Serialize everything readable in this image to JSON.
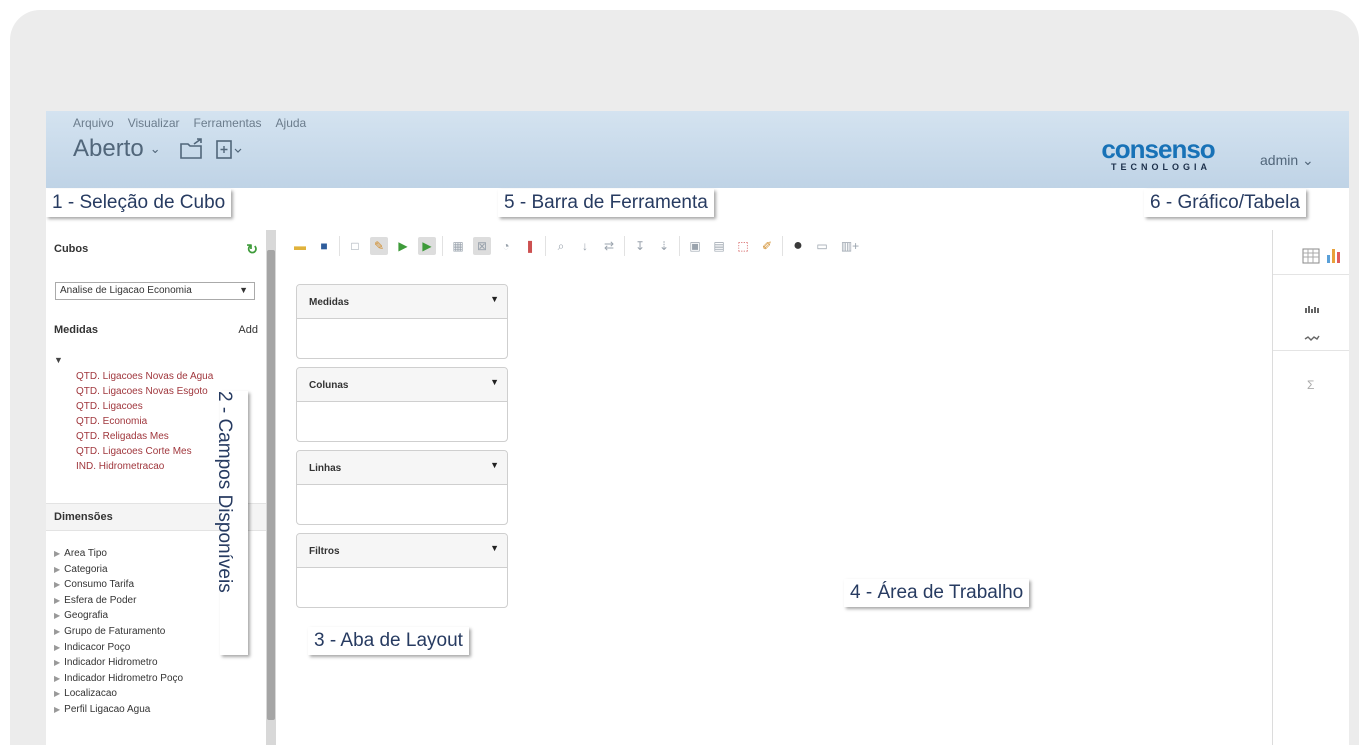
{
  "menu": [
    "Arquivo",
    "Visualizar",
    "Ferramentas",
    "Ajuda"
  ],
  "header": {
    "open_label": "Aberto",
    "open_chevron": "⌄",
    "logo_main": "consenso",
    "logo_sub": "TECNOLOGIA",
    "user": "admin ⌄"
  },
  "callouts": {
    "cube": "1 - Seleção de Cubo",
    "fields": "2 - Campos Disponíveis",
    "layout": "3 - Aba de Layout",
    "work": "4 - Área de Trabalho",
    "toolbar": "5 - Barra de Ferramenta",
    "chart": "6 - Gráfico/Tabela"
  },
  "sidebar": {
    "cubes_title": "Cubos",
    "cube_selected": "Analise de Ligacao Economia",
    "measures_title": "Medidas",
    "add_label": "Add",
    "measures": [
      "QTD. Ligacoes Novas de Agua",
      "QTD. Ligacoes Novas Esgoto",
      "QTD. Ligacoes",
      "QTD. Economia",
      "QTD. Religadas Mes",
      "QTD. Ligacoes Corte Mes",
      "IND. Hidrometracao"
    ],
    "dimensions_title": "Dimensões",
    "dimensions": [
      "Area Tipo",
      "Categoria",
      "Consumo Tarifa",
      "Esfera de Poder",
      "Geografia",
      "Grupo de Faturamento",
      "Indicacor Poço",
      "Indicador Hidrometro",
      "Indicador Hidrometro Poço",
      "Localizacao",
      "Perfil Ligacao Agua"
    ]
  },
  "panels": {
    "measures": "Medidas",
    "columns": "Colunas",
    "rows": "Linhas",
    "filters": "Filtros"
  },
  "icons": {
    "folder": "folder-icon",
    "save": "save-icon",
    "refresh": "refresh-icon",
    "table": "table-icon",
    "bar_chart": "bar-chart-icon",
    "line": "line-chart-icon",
    "sum": "sum-icon"
  },
  "colors": {
    "header_bg": "#c9dbec",
    "logo_blue": "#1872b7",
    "measure_text": "#a0373d",
    "callout_text": "#273b61"
  }
}
